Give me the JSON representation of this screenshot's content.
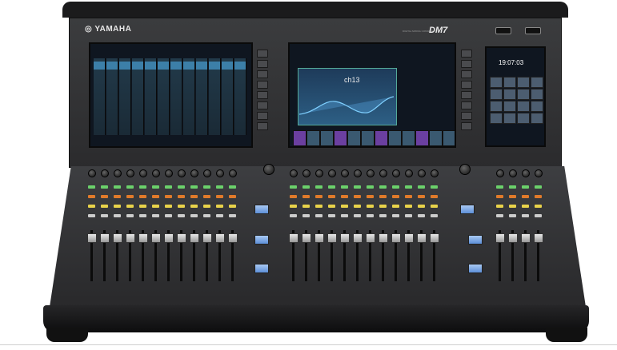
{
  "brand": {
    "logo": "YAMAHA",
    "model": "DM7",
    "model_subtitle": "DIGITAL MIXING CONSOLE"
  },
  "screens": {
    "center_channel_label": "ch13",
    "right_clock": "19:07:03"
  },
  "ports": [
    {
      "name": "usb-port-left"
    },
    {
      "name": "usb-port-right"
    }
  ],
  "colors": {
    "body": "#2a2a2c",
    "screen_bg": "#0f1620",
    "eq_panel": "#2d5f85",
    "accent_green": "#6bd16b",
    "accent_orange": "#e07a2a",
    "accent_yellow": "#e8d24a"
  },
  "icons": [
    "yamaha-tuning-fork-icon",
    "usb-icon"
  ]
}
